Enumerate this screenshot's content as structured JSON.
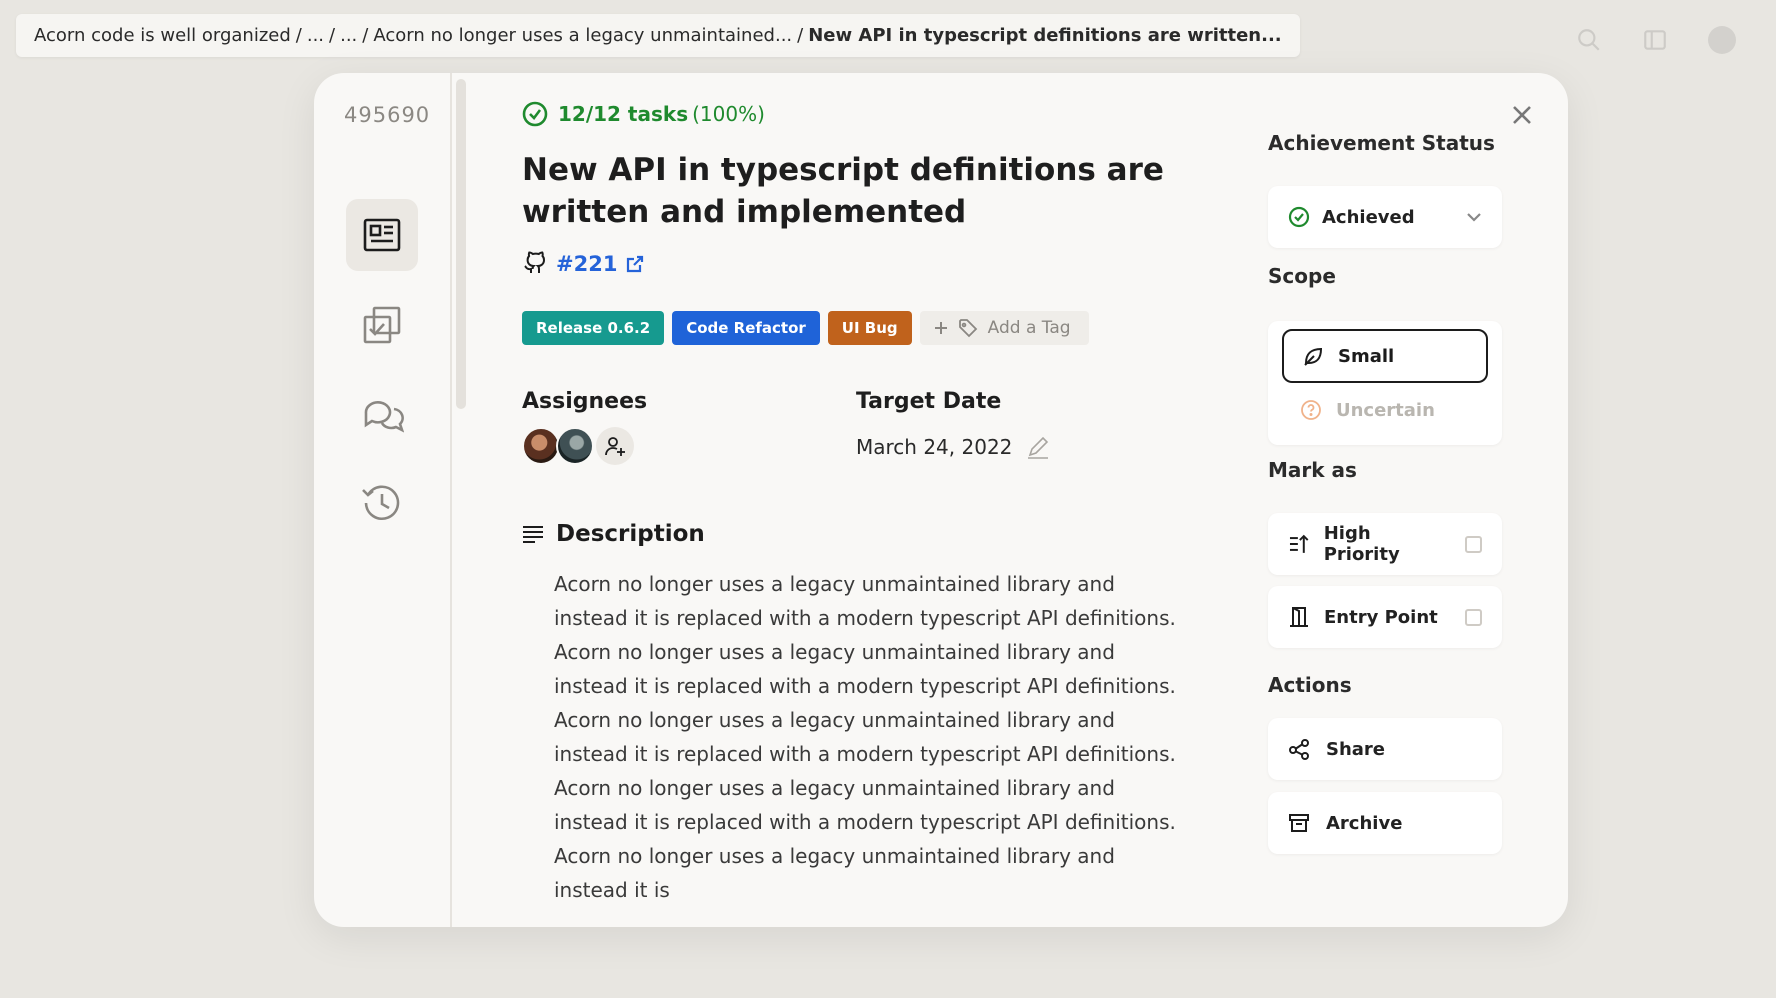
{
  "breadcrumb": {
    "crumbs": [
      "Acorn code is well organized",
      "...",
      "...",
      "Acorn no longer uses a legacy unmaintained..."
    ],
    "current": "New API in typescript definitions are written..."
  },
  "item": {
    "id": "495690",
    "tasks_count": "12/12 tasks",
    "tasks_percent": "(100%)",
    "title": "New API in typescript definitions are written and implemented",
    "issue_number": "#221"
  },
  "tags": [
    {
      "label": "Release 0.6.2",
      "color": "#169a8f"
    },
    {
      "label": "Code Refactor",
      "color": "#1f63d8"
    },
    {
      "label": "UI Bug",
      "color": "#c0621c"
    }
  ],
  "add_tag_label": "Add a Tag",
  "assignees_label": "Assignees",
  "target_label": "Target Date",
  "target_date": "March 24, 2022",
  "description": {
    "heading": "Description",
    "body": "Acorn no longer uses a legacy unmaintained library and instead it is replaced with a modern typescript API definitions. Acorn no longer uses a legacy unmaintained library and instead it is replaced with a modern typescript API definitions. Acorn no longer uses a legacy unmaintained library and instead it is replaced with a modern typescript API definitions. Acorn no longer uses a legacy unmaintained library and instead it is replaced with a modern typescript API definitions. Acorn no longer uses a legacy unmaintained library and instead it is"
  },
  "side": {
    "status_label": "Achievement Status",
    "status_value": "Achieved",
    "scope_label": "Scope",
    "scope_options": [
      "Small",
      "Uncertain"
    ],
    "mark_label": "Mark as",
    "mark_options": [
      "High Priority",
      "Entry Point"
    ],
    "actions_label": "Actions",
    "actions": [
      "Share",
      "Archive"
    ]
  },
  "colors": {
    "success": "#1f8a2e",
    "link": "#2563d9",
    "uncertain": "#f0b28a"
  }
}
